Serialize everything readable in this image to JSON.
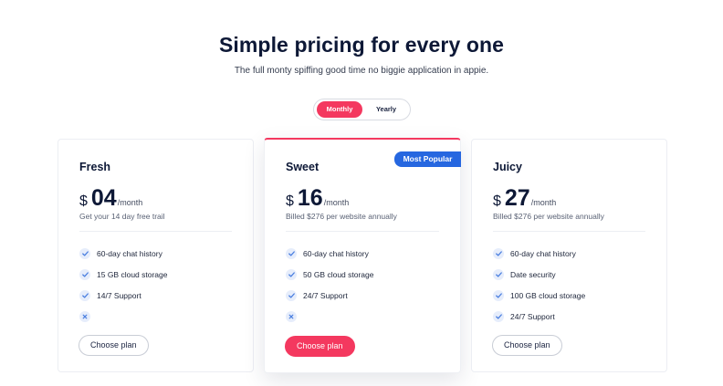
{
  "header": {
    "title": "Simple pricing for every one",
    "subtitle": "The full monty spiffing good time no biggie application in appie."
  },
  "billing_toggle": {
    "monthly_label": "Monthly",
    "yearly_label": "Yearly",
    "selected": "Monthly"
  },
  "colors": {
    "accent": "#f4385f",
    "badge": "#2667e0",
    "check": "#4a7fe0"
  },
  "plans": [
    {
      "name": "Fresh",
      "currency": "$",
      "price": "04",
      "period": "/month",
      "note": "Get your 14 day free trail",
      "features": [
        {
          "text": "60-day chat history",
          "icon": "check-icon"
        },
        {
          "text": "15 GB cloud storage",
          "icon": "check-icon"
        },
        {
          "text": "14/7 Support",
          "icon": "check-icon"
        },
        {
          "text": "",
          "icon": "x-icon"
        }
      ],
      "button": "Choose plan"
    },
    {
      "name": "Sweet",
      "badge": "Most Popular",
      "currency": "$",
      "price": "16",
      "period": "/month",
      "note": "Billed $276 per website annually",
      "features": [
        {
          "text": "60-day chat history",
          "icon": "check-icon"
        },
        {
          "text": "50 GB cloud storage",
          "icon": "check-icon"
        },
        {
          "text": "24/7 Support",
          "icon": "check-icon"
        },
        {
          "text": "",
          "icon": "x-icon"
        }
      ],
      "button": "Choose plan"
    },
    {
      "name": "Juicy",
      "currency": "$",
      "price": "27",
      "period": "/month",
      "note": "Billed $276 per website annually",
      "features": [
        {
          "text": "60-day chat history",
          "icon": "check-icon"
        },
        {
          "text": "Date security",
          "icon": "check-icon"
        },
        {
          "text": "100 GB cloud storage",
          "icon": "check-icon"
        },
        {
          "text": "24/7 Support",
          "icon": "check-icon"
        }
      ],
      "button": "Choose plan"
    }
  ]
}
